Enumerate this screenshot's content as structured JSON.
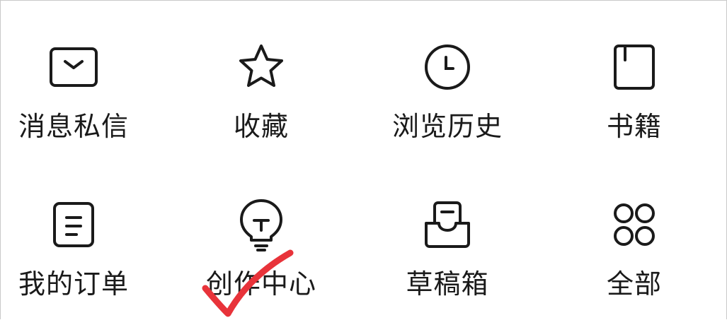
{
  "grid": {
    "items": [
      {
        "label": "消息私信",
        "icon": "mail-icon"
      },
      {
        "label": "收藏",
        "icon": "star-icon"
      },
      {
        "label": "浏览历史",
        "icon": "clock-icon"
      },
      {
        "label": "书籍",
        "icon": "book-icon"
      },
      {
        "label": "我的订单",
        "icon": "order-icon"
      },
      {
        "label": "创作中心",
        "icon": "lightbulb-icon"
      },
      {
        "label": "草稿箱",
        "icon": "drafts-box-icon"
      },
      {
        "label": "全部",
        "icon": "grid-all-icon"
      }
    ]
  },
  "annotation": {
    "mark": "red-checkmark",
    "color": "#e8333a"
  },
  "colors": {
    "icon_stroke": "#1a1a1a",
    "text": "#1a1a1a",
    "background": "#ffffff"
  }
}
